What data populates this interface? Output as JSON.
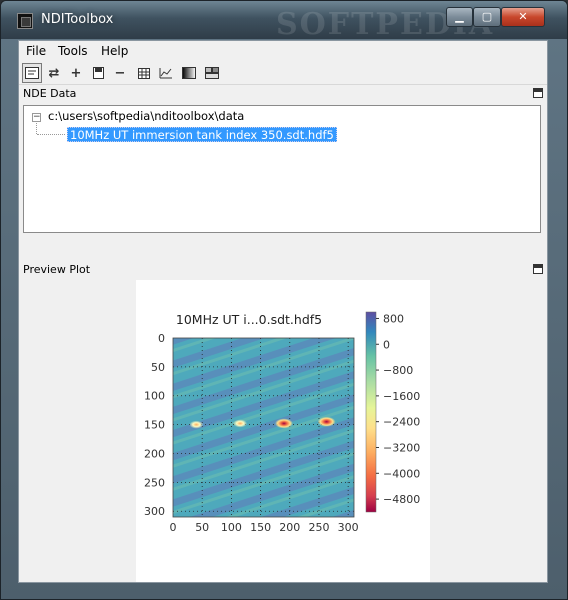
{
  "window": {
    "title": "NDIToolbox",
    "watermark": "SOFTPEDIA"
  },
  "menu": [
    "File",
    "Tools",
    "Help"
  ],
  "toolbar": {
    "icons": [
      "preview-icon",
      "refresh-icon",
      "add-icon",
      "save-icon",
      "remove-icon",
      "table-icon",
      "line-plot-icon",
      "image-plot-icon",
      "mega-plot-icon"
    ]
  },
  "nde_panel": {
    "title": "NDE Data",
    "tree_root": "c:\\users\\softpedia\\nditoolbox\\data",
    "tree_child": "10MHz UT immersion tank index 350.sdt.hdf5",
    "expander": "−"
  },
  "preview_panel": {
    "title": "Preview Plot"
  },
  "chart_data": {
    "type": "heatmap",
    "title": "10MHz UT i...0.sdt.hdf5",
    "xlim": [
      0,
      310
    ],
    "ylim": [
      310,
      0
    ],
    "x_ticks": [
      "0",
      "50",
      "100",
      "150",
      "200",
      "250",
      "300"
    ],
    "y_ticks": [
      "0",
      "50",
      "100",
      "150",
      "200",
      "250",
      "300"
    ],
    "x_tick_values": [
      0,
      50,
      100,
      150,
      200,
      250,
      300
    ],
    "y_tick_values": [
      0,
      50,
      100,
      150,
      200,
      250,
      300
    ],
    "colorbar_ticks": [
      "800",
      "0",
      "−800",
      "−1600",
      "−2400",
      "−3200",
      "−4000",
      "−4800"
    ],
    "colorbar_values": [
      800,
      0,
      -800,
      -1600,
      -2400,
      -3200,
      -4000,
      -4800
    ],
    "colorbar_range": [
      -5200,
      1000
    ],
    "grid": true,
    "hot_spots": [
      {
        "x": 40,
        "y": 150,
        "intensity": "low"
      },
      {
        "x": 115,
        "y": 148,
        "intensity": "low"
      },
      {
        "x": 190,
        "y": 148,
        "intensity": "high"
      },
      {
        "x": 263,
        "y": 145,
        "intensity": "high"
      }
    ],
    "colors": {
      "background_field": "#4aa6b8",
      "stripe": "#5c7fb8",
      "spot_high": "#e04522",
      "spot_low": "#f6f2b0"
    }
  }
}
